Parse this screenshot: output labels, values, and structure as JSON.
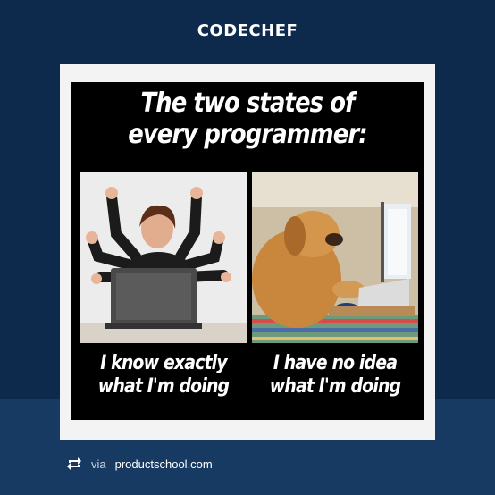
{
  "header": {
    "logo_text": "CODECHEF"
  },
  "meme": {
    "title_line1": "The two states of",
    "title_line2": "every programmer:",
    "left_caption_line1": "I know exactly",
    "left_caption_line2": "what I'm doing",
    "right_caption_line1": "I have no idea",
    "right_caption_line2": "what I'm doing"
  },
  "footer": {
    "repost_icon": "repost-icon",
    "via_label": "via",
    "source": "productschool.com"
  },
  "colors": {
    "background_top": "#0d2a4d",
    "background_bottom": "#173a63",
    "card": "#f3f3f3",
    "meme_bg": "#000000"
  }
}
